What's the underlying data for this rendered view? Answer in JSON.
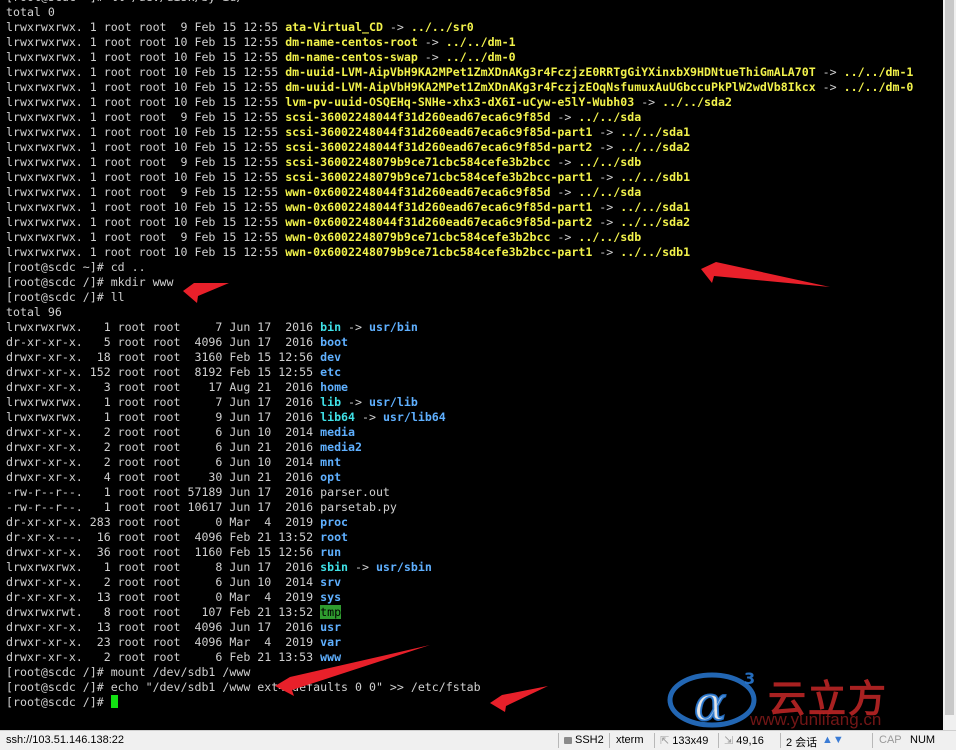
{
  "terminal": {
    "lines": [
      {
        "t": "plain",
        "text": "[root@scdc ~]# ll /dev/disk/by-id/"
      },
      {
        "t": "plain",
        "text": "total 0"
      },
      {
        "t": "entry",
        "perm": "lrwxrwxrwx. 1 root root  9 Feb 15 12:55 ",
        "name": "ata-Virtual_CD",
        "cls": "c-link",
        "sep": " -> ",
        "target": "../../sr0",
        "tcls": "c-link"
      },
      {
        "t": "entry",
        "perm": "lrwxrwxrwx. 1 root root 10 Feb 15 12:55 ",
        "name": "dm-name-centos-root",
        "cls": "c-link",
        "sep": " -> ",
        "target": "../../dm-1",
        "tcls": "c-link"
      },
      {
        "t": "entry",
        "perm": "lrwxrwxrwx. 1 root root 10 Feb 15 12:55 ",
        "name": "dm-name-centos-swap",
        "cls": "c-link",
        "sep": " -> ",
        "target": "../../dm-0",
        "tcls": "c-link"
      },
      {
        "t": "entry",
        "perm": "lrwxrwxrwx. 1 root root 10 Feb 15 12:55 ",
        "name": "dm-uuid-LVM-AipVbH9KA2MPet1ZmXDnAKg3r4FczjzE0RRTgGiYXinxbX9HDNtueThiGmALA70T",
        "cls": "c-link",
        "sep": " -> ",
        "target": "../../dm-1",
        "tcls": "c-link"
      },
      {
        "t": "entry",
        "perm": "lrwxrwxrwx. 1 root root 10 Feb 15 12:55 ",
        "name": "dm-uuid-LVM-AipVbH9KA2MPet1ZmXDnAKg3r4FczjzEOqNsfumuxAuUGbccuPkPlW2wdVb8Ikcx",
        "cls": "c-link",
        "sep": " -> ",
        "target": "../../dm-0",
        "tcls": "c-link"
      },
      {
        "t": "entry",
        "perm": "lrwxrwxrwx. 1 root root 10 Feb 15 12:55 ",
        "name": "lvm-pv-uuid-OSQEHq-SNHe-xhx3-dX6I-uCyw-e5lY-Wubh03",
        "cls": "c-link",
        "sep": " -> ",
        "target": "../../sda2",
        "tcls": "c-link"
      },
      {
        "t": "entry",
        "perm": "lrwxrwxrwx. 1 root root  9 Feb 15 12:55 ",
        "name": "scsi-36002248044f31d260ead67eca6c9f85d",
        "cls": "c-link",
        "sep": " -> ",
        "target": "../../sda",
        "tcls": "c-link"
      },
      {
        "t": "entry",
        "perm": "lrwxrwxrwx. 1 root root 10 Feb 15 12:55 ",
        "name": "scsi-36002248044f31d260ead67eca6c9f85d-part1",
        "cls": "c-link",
        "sep": " -> ",
        "target": "../../sda1",
        "tcls": "c-link"
      },
      {
        "t": "entry",
        "perm": "lrwxrwxrwx. 1 root root 10 Feb 15 12:55 ",
        "name": "scsi-36002248044f31d260ead67eca6c9f85d-part2",
        "cls": "c-link",
        "sep": " -> ",
        "target": "../../sda2",
        "tcls": "c-link"
      },
      {
        "t": "entry",
        "perm": "lrwxrwxrwx. 1 root root  9 Feb 15 12:55 ",
        "name": "scsi-36002248079b9ce71cbc584cefe3b2bcc",
        "cls": "c-link",
        "sep": " -> ",
        "target": "../../sdb",
        "tcls": "c-link"
      },
      {
        "t": "entry",
        "perm": "lrwxrwxrwx. 1 root root 10 Feb 15 12:55 ",
        "name": "scsi-36002248079b9ce71cbc584cefe3b2bcc-part1",
        "cls": "c-link",
        "sep": " -> ",
        "target": "../../sdb1",
        "tcls": "c-link"
      },
      {
        "t": "entry",
        "perm": "lrwxrwxrwx. 1 root root  9 Feb 15 12:55 ",
        "name": "wwn-0x6002248044f31d260ead67eca6c9f85d",
        "cls": "c-link",
        "sep": " -> ",
        "target": "../../sda",
        "tcls": "c-link"
      },
      {
        "t": "entry",
        "perm": "lrwxrwxrwx. 1 root root 10 Feb 15 12:55 ",
        "name": "wwn-0x6002248044f31d260ead67eca6c9f85d-part1",
        "cls": "c-link",
        "sep": " -> ",
        "target": "../../sda1",
        "tcls": "c-link"
      },
      {
        "t": "entry",
        "perm": "lrwxrwxrwx. 1 root root 10 Feb 15 12:55 ",
        "name": "wwn-0x6002248044f31d260ead67eca6c9f85d-part2",
        "cls": "c-link",
        "sep": " -> ",
        "target": "../../sda2",
        "tcls": "c-link"
      },
      {
        "t": "entry",
        "perm": "lrwxrwxrwx. 1 root root  9 Feb 15 12:55 ",
        "name": "wwn-0x6002248079b9ce71cbc584cefe3b2bcc",
        "cls": "c-link",
        "sep": " -> ",
        "target": "../../sdb",
        "tcls": "c-link"
      },
      {
        "t": "entry",
        "perm": "lrwxrwxrwx. 1 root root 10 Feb 15 12:55 ",
        "name": "wwn-0x6002248079b9ce71cbc584cefe3b2bcc-part1",
        "cls": "c-link",
        "sep": " -> ",
        "target": "../../sdb1",
        "tcls": "c-link"
      },
      {
        "t": "plain",
        "text": "[root@scdc ~]# cd .."
      },
      {
        "t": "plain",
        "text": "[root@scdc /]# mkdir www"
      },
      {
        "t": "plain",
        "text": "[root@scdc /]# ll"
      },
      {
        "t": "plain",
        "text": "total 96"
      },
      {
        "t": "entry",
        "perm": "lrwxrwxrwx.   1 root root     7 Jun 17  2016 ",
        "name": "bin",
        "cls": "c-lnk",
        "sep": " -> ",
        "target": "usr/bin",
        "tcls": "c-hl"
      },
      {
        "t": "entry",
        "perm": "dr-xr-xr-x.   5 root root  4096 Jun 17  2016 ",
        "name": "boot",
        "cls": "c-dir"
      },
      {
        "t": "entry",
        "perm": "drwxr-xr-x.  18 root root  3160 Feb 15 12:56 ",
        "name": "dev",
        "cls": "c-dir"
      },
      {
        "t": "entry",
        "perm": "drwxr-xr-x. 152 root root  8192 Feb 15 12:55 ",
        "name": "etc",
        "cls": "c-dir"
      },
      {
        "t": "entry",
        "perm": "drwxr-xr-x.   3 root root    17 Aug 21  2016 ",
        "name": "home",
        "cls": "c-dir"
      },
      {
        "t": "entry",
        "perm": "lrwxrwxrwx.   1 root root     7 Jun 17  2016 ",
        "name": "lib",
        "cls": "c-lnk",
        "sep": " -> ",
        "target": "usr/lib",
        "tcls": "c-hl"
      },
      {
        "t": "entry",
        "perm": "lrwxrwxrwx.   1 root root     9 Jun 17  2016 ",
        "name": "lib64",
        "cls": "c-lnk",
        "sep": " -> ",
        "target": "usr/lib64",
        "tcls": "c-hl"
      },
      {
        "t": "entry",
        "perm": "drwxr-xr-x.   2 root root     6 Jun 10  2014 ",
        "name": "media",
        "cls": "c-dir"
      },
      {
        "t": "entry",
        "perm": "drwxr-xr-x.   2 root root     6 Jun 21  2016 ",
        "name": "media2",
        "cls": "c-dir"
      },
      {
        "t": "entry",
        "perm": "drwxr-xr-x.   2 root root     6 Jun 10  2014 ",
        "name": "mnt",
        "cls": "c-dir"
      },
      {
        "t": "entry",
        "perm": "drwxr-xr-x.   4 root root    30 Jun 21  2016 ",
        "name": "opt",
        "cls": "c-dir"
      },
      {
        "t": "entry",
        "perm": "-rw-r--r--.   1 root root 57189 Jun 17  2016 ",
        "name": "parser.out",
        "cls": "c-file"
      },
      {
        "t": "entry",
        "perm": "-rw-r--r--.   1 root root 10617 Jun 17  2016 ",
        "name": "parsetab.py",
        "cls": "c-file"
      },
      {
        "t": "entry",
        "perm": "dr-xr-xr-x. 283 root root     0 Mar  4  2019 ",
        "name": "proc",
        "cls": "c-dir"
      },
      {
        "t": "entry",
        "perm": "dr-xr-x---.  16 root root  4096 Feb 21 13:52 ",
        "name": "root",
        "cls": "c-dir"
      },
      {
        "t": "entry",
        "perm": "drwxr-xr-x.  36 root root  1160 Feb 15 12:56 ",
        "name": "run",
        "cls": "c-dir"
      },
      {
        "t": "entry",
        "perm": "lrwxrwxrwx.   1 root root     8 Jun 17  2016 ",
        "name": "sbin",
        "cls": "c-lnk",
        "sep": " -> ",
        "target": "usr/sbin",
        "tcls": "c-hl"
      },
      {
        "t": "entry",
        "perm": "drwxr-xr-x.   2 root root     6 Jun 10  2014 ",
        "name": "srv",
        "cls": "c-dir"
      },
      {
        "t": "entry",
        "perm": "dr-xr-xr-x.  13 root root     0 Mar  4  2019 ",
        "name": "sys",
        "cls": "c-dir"
      },
      {
        "t": "entry",
        "perm": "drwxrwxrwt.   8 root root   107 Feb 21 13:52 ",
        "name": "tmp",
        "cls": "c-sticky"
      },
      {
        "t": "entry",
        "perm": "drwxr-xr-x.  13 root root  4096 Jun 17  2016 ",
        "name": "usr",
        "cls": "c-dir"
      },
      {
        "t": "entry",
        "perm": "drwxr-xr-x.  23 root root  4096 Mar  4  2019 ",
        "name": "var",
        "cls": "c-dir"
      },
      {
        "t": "entry",
        "perm": "drwxr-xr-x.   2 root root     6 Feb 21 13:53 ",
        "name": "www",
        "cls": "c-dir"
      },
      {
        "t": "plain",
        "text": "[root@scdc /]# mount /dev/sdb1 /www"
      },
      {
        "t": "plain",
        "text": "[root@scdc /]# echo \"/dev/sdb1 /www ext4 defaults 0 0\" >> /etc/fstab"
      },
      {
        "t": "prompt",
        "text": "[root@scdc /]# "
      }
    ]
  },
  "statusbar": {
    "connection": "ssh://103.51.146.138:22",
    "protocol": "SSH2",
    "term_type": "xterm",
    "size": "133x49",
    "cursor_pos": "49,16",
    "sessions": "2 会话",
    "caps": "CAP",
    "num": "NUM"
  },
  "watermark": {
    "logo_text": "云立方",
    "url": "www.yunlifang.cn",
    "superscript": "3"
  },
  "colors": {
    "annotation_arrow": "#e8202a",
    "cursor": "#12e012",
    "symlink": "#f2f24b",
    "directory": "#5fb0ff"
  }
}
